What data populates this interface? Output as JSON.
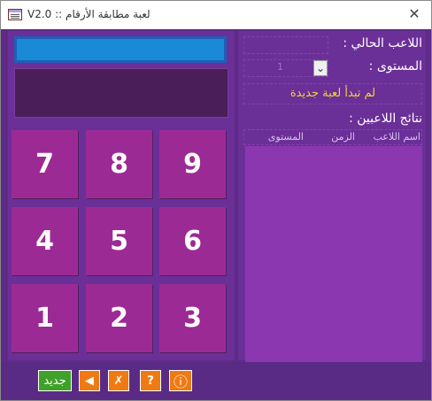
{
  "window": {
    "title": "لعبة مطابقة الأرقام :: V2.0",
    "close_glyph": "✕"
  },
  "keypad": {
    "keys": [
      "7",
      "8",
      "9",
      "4",
      "5",
      "6",
      "1",
      "2",
      "3"
    ]
  },
  "player": {
    "current_label": "اللاعب الحالي :",
    "level_label": "المستوى :",
    "level_value": "1",
    "select_glyph": "⌄"
  },
  "status": {
    "message": "لم تبدأ لعبة جديدة"
  },
  "results": {
    "title": "نتائج اللاعبين :",
    "columns": [
      "اسم اللاعب",
      "الزمن",
      "المستوى"
    ]
  },
  "toolbar": {
    "new_label": "جديد",
    "back_glyph": "◀",
    "cancel_glyph": "✗",
    "help_glyph": "?",
    "info_glyph": "ⓘ"
  },
  "colors": {
    "background": "#5e2b86",
    "panel": "#6b2f98",
    "key": "#9c2a95",
    "display_blue": "#1a8ad6",
    "status_text": "#f4d23c",
    "new_button": "#3fa12a",
    "orange_button": "#f07a12"
  }
}
